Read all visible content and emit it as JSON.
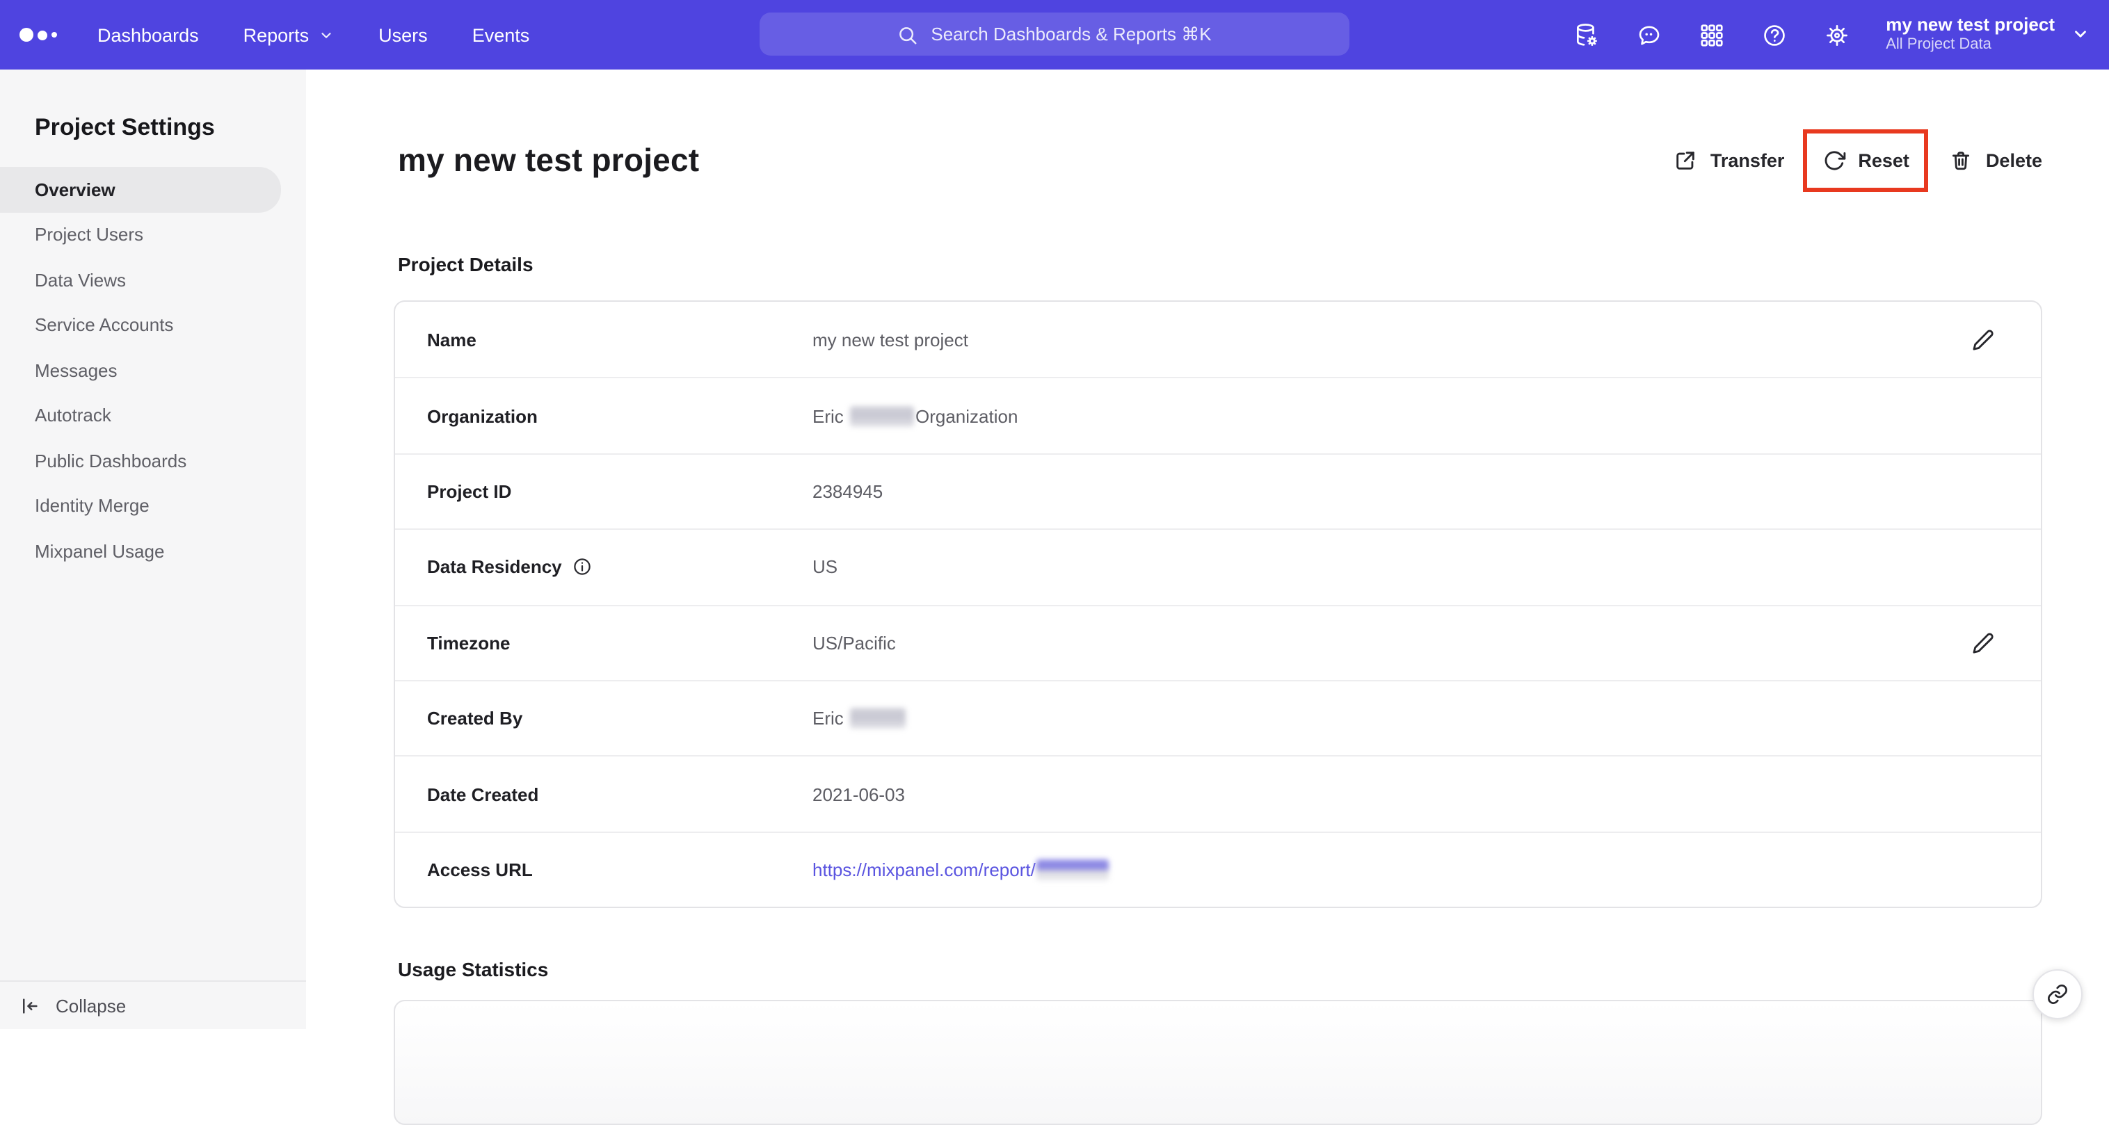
{
  "navbar": {
    "links": [
      {
        "label": "Dashboards",
        "has_dropdown": false
      },
      {
        "label": "Reports",
        "has_dropdown": true
      },
      {
        "label": "Users",
        "has_dropdown": false
      },
      {
        "label": "Events",
        "has_dropdown": false
      }
    ],
    "search": {
      "placeholder": "Search Dashboards & Reports ⌘K"
    },
    "icons": [
      {
        "name": "data-management-icon"
      },
      {
        "name": "feedback-icon"
      },
      {
        "name": "apps-grid-icon"
      },
      {
        "name": "help-icon"
      },
      {
        "name": "settings-gear-icon"
      }
    ],
    "project_selector": {
      "name": "my new test project",
      "scope": "All Project Data"
    }
  },
  "sidebar": {
    "title": "Project Settings",
    "items": [
      {
        "label": "Overview",
        "active": true
      },
      {
        "label": "Project Users",
        "active": false
      },
      {
        "label": "Data Views",
        "active": false
      },
      {
        "label": "Service Accounts",
        "active": false
      },
      {
        "label": "Messages",
        "active": false
      },
      {
        "label": "Autotrack",
        "active": false
      },
      {
        "label": "Public Dashboards",
        "active": false
      },
      {
        "label": "Identity Merge",
        "active": false
      },
      {
        "label": "Mixpanel Usage",
        "active": false
      }
    ],
    "collapse_label": "Collapse"
  },
  "main": {
    "title": "my new test project",
    "actions": [
      {
        "label": "Transfer",
        "icon": "transfer-icon",
        "annotated": false
      },
      {
        "label": "Reset",
        "icon": "reset-icon",
        "annotated": true
      },
      {
        "label": "Delete",
        "icon": "delete-icon",
        "annotated": false
      }
    ],
    "project_details": {
      "heading": "Project Details",
      "rows": [
        {
          "label": "Name",
          "value": "my new test project",
          "editable": true
        },
        {
          "label": "Organization",
          "value_prefix": "Eric",
          "redacted": "medium",
          "value_suffix": "Organization"
        },
        {
          "label": "Project ID",
          "value": "2384945"
        },
        {
          "label": "Data Residency",
          "info": true,
          "value": "US"
        },
        {
          "label": "Timezone",
          "value": "US/Pacific",
          "editable": true
        },
        {
          "label": "Created By",
          "value_prefix": "Eric",
          "redacted": "small"
        },
        {
          "label": "Date Created",
          "value": "2021-06-03"
        },
        {
          "label": "Access URL",
          "link": "https://mixpanel.com/report/",
          "redacted": "link"
        }
      ]
    },
    "usage_statistics": {
      "heading": "Usage Statistics"
    }
  },
  "colors": {
    "brand_purple": "#4f44e0",
    "annotation_red": "#e8391f",
    "link_blue": "#5a54e0",
    "sidebar_bg": "#f6f6f7",
    "active_pill": "#e8e8ea"
  }
}
